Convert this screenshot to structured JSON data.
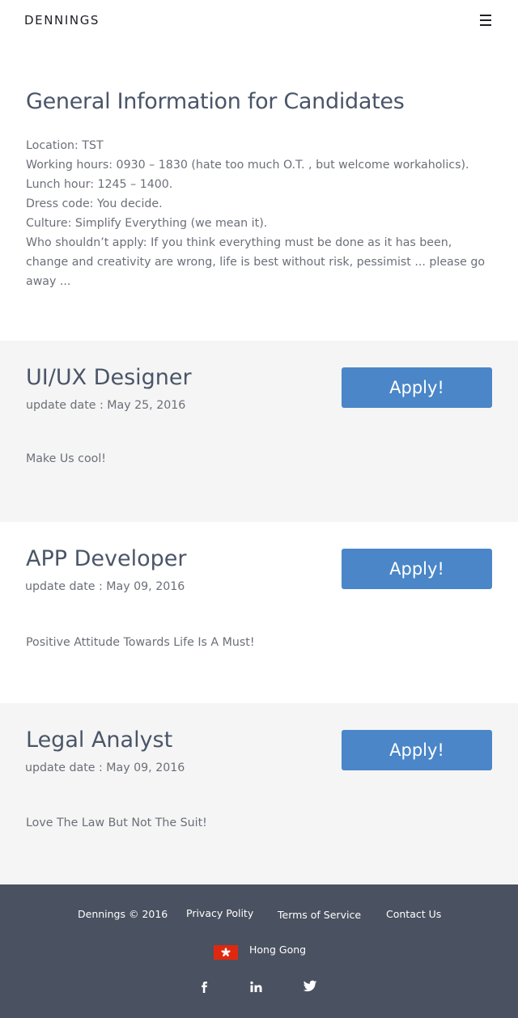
{
  "header": {
    "logo": "DENNINGS",
    "menu_icon": "hamburger-menu-icon"
  },
  "info": {
    "title": "General Information for Candidates",
    "lines": [
      "Location: TST",
      "Working hours: 0930 – 1830 (hate too much O.T. , but welcome workaholics).",
      "Lunch hour: 1245 – 1400.",
      "Dress code: You decide.",
      "Culture: Simplify Everything (we mean it).",
      "Who shouldn’t apply: If you think everything must be done as it has been, change and creativity are wrong, life is best without risk, pessimist  ... please go away ..."
    ]
  },
  "jobs": [
    {
      "title": "UI/UX Designer",
      "date": "update date : May 25, 2016",
      "desc": "Make Us cool!",
      "apply": "Apply!"
    },
    {
      "title": "APP Developer",
      "date": "update date : May 09, 2016",
      "desc": "Positive Attitude Towards Life Is A Must!",
      "apply": "Apply!"
    },
    {
      "title": "Legal Analyst",
      "date": "update date : May 09, 2016",
      "desc": "Love The Law But Not The Suit!",
      "apply": "Apply!"
    }
  ],
  "footer": {
    "copyright": "Dennings © 2016",
    "privacy": "Privacy Polity",
    "terms": "Terms of Service",
    "contact": "Contact Us",
    "region": "Hong Gong",
    "region_flag_icon": "hong-kong-flag-icon",
    "social": [
      "facebook-icon",
      "linkedin-icon",
      "twitter-icon"
    ]
  },
  "colors": {
    "accent": "#4a86c8",
    "footer_bg": "#4a5160",
    "section_gray": "#f5f5f5",
    "heading": "#4a5568",
    "body_text": "#6b6f78",
    "flag_red": "#de2910"
  }
}
